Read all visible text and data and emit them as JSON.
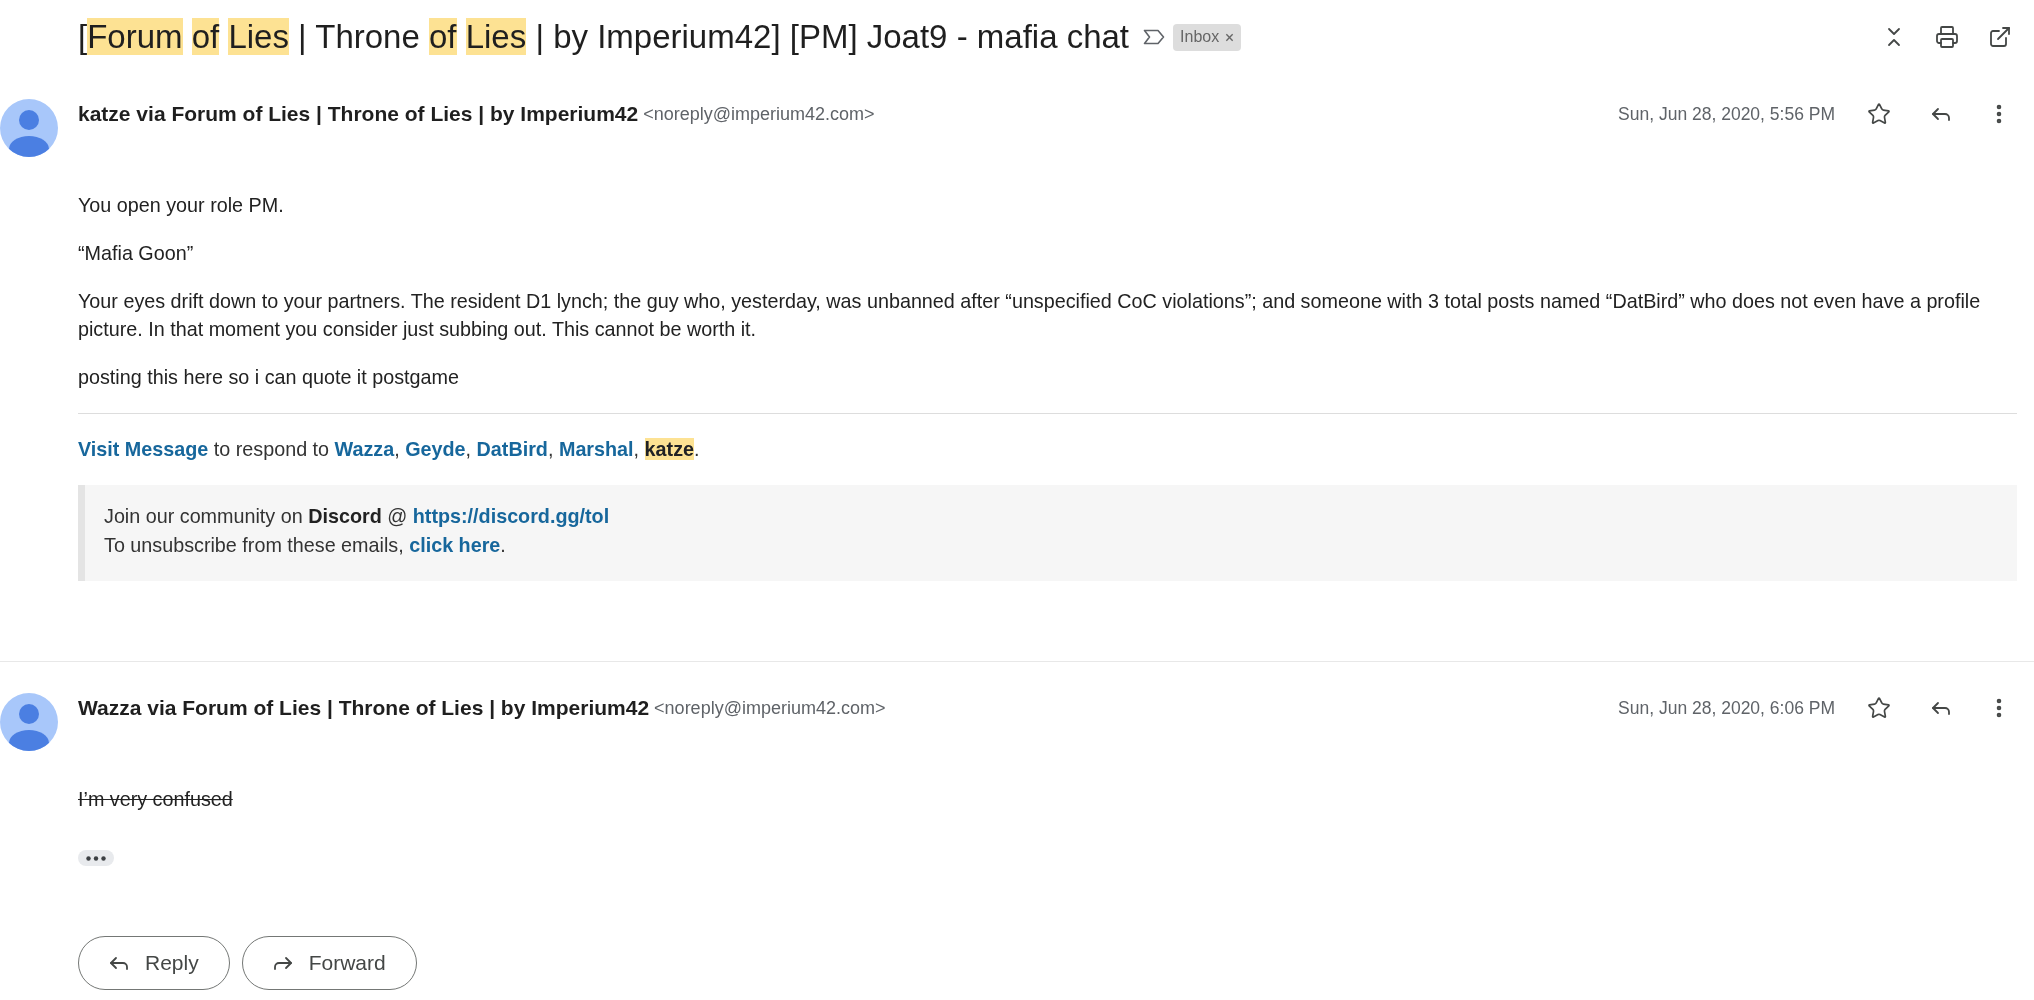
{
  "thread": {
    "subject": [
      {
        "text": "[",
        "highlighted": false
      },
      {
        "text": "Forum",
        "highlighted": true,
        "space_after": true
      },
      {
        "text": "of",
        "highlighted": true,
        "space_after": true
      },
      {
        "text": "Lies",
        "highlighted": true
      },
      {
        "text": " | Throne ",
        "highlighted": false
      },
      {
        "text": "of",
        "highlighted": true,
        "space_after": true
      },
      {
        "text": "Lies",
        "highlighted": true
      },
      {
        "text": " | by Imperium42] [PM] Joat9 - mafia chat",
        "highlighted": false
      }
    ],
    "important": false,
    "labels": [
      {
        "name": "Inbox"
      }
    ]
  },
  "messages": [
    {
      "sender": "katze via Forum of Lies | Throne of Lies | by Imperium42",
      "email": "<noreply@imperium42.com>",
      "date": "Sun, Jun 28, 2020, 5:56 PM",
      "starred": false,
      "paragraphs": [
        {
          "text": "You open your role PM.",
          "strikethrough": false
        },
        {
          "text": "“Mafia Goon”",
          "strikethrough": false
        },
        {
          "text": "Your eyes drift down to your partners. The resident D1 lynch; the guy who, yesterday, was unbanned after “unspecified CoC violations”; and someone with 3 total posts named “DatBird” who does not even have a profile picture. In that moment you consider just subbing out. This cannot be worth it.",
          "strikethrough": false
        },
        {
          "text": "posting this here so i can quote it postgame",
          "strikethrough": false
        }
      ],
      "respond": {
        "link": "Visit Message",
        "text": "to respond to",
        "recipients": [
          {
            "name": "Wazza",
            "highlighted": false,
            "after": ","
          },
          {
            "name": "Geyde",
            "highlighted": false,
            "after": ","
          },
          {
            "name": "DatBird",
            "highlighted": false,
            "after": ","
          },
          {
            "name": "Marshal",
            "highlighted": false,
            "after": ","
          },
          {
            "name": "katze",
            "highlighted": true,
            "after": "."
          }
        ]
      },
      "notice": [
        {
          "text": "Join our community on **Discord** @",
          "link": "https://discord.gg/tol"
        },
        {
          "text": "To unsubscribe from these emails,",
          "link": "click here",
          "after": "."
        }
      ]
    },
    {
      "sender": "Wazza via Forum of Lies | Throne of Lies | by Imperium42",
      "email": "<noreply@imperium42.com>",
      "date": "Sun, Jun 28, 2020, 6:06 PM",
      "starred": false,
      "paragraphs": [
        {
          "text": "I’m very confused",
          "strikethrough": true
        }
      ],
      "trimmed": true
    }
  ],
  "actions": [
    {
      "kind": "reply",
      "label": "Reply"
    },
    {
      "kind": "forward",
      "label": "Forward"
    }
  ]
}
